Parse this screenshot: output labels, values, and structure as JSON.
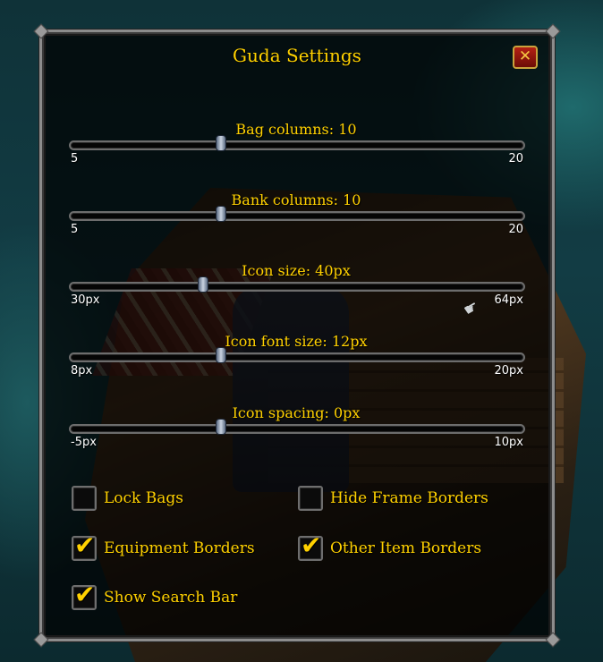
{
  "window": {
    "title": "Guda Settings",
    "close_glyph": "✕"
  },
  "sliders": [
    {
      "label": "Bag columns: 10",
      "min": "5",
      "max": "20",
      "value": 10,
      "range": [
        5,
        20
      ]
    },
    {
      "label": "Bank columns: 10",
      "min": "5",
      "max": "20",
      "value": 10,
      "range": [
        5,
        20
      ]
    },
    {
      "label": "Icon size: 40px",
      "min": "30px",
      "max": "64px",
      "value": 40,
      "range": [
        30,
        64
      ]
    },
    {
      "label": "Icon font size: 12px",
      "min": "8px",
      "max": "20px",
      "value": 12,
      "range": [
        8,
        20
      ]
    },
    {
      "label": "Icon spacing: 0px",
      "min": "-5px",
      "max": "10px",
      "value": 0,
      "range": [
        -5,
        10
      ]
    }
  ],
  "checkboxes": [
    {
      "label": "Lock Bags",
      "checked": false
    },
    {
      "label": "Hide Frame Borders",
      "checked": false
    },
    {
      "label": "Equipment Borders",
      "checked": true
    },
    {
      "label": "Other Item Borders",
      "checked": true
    },
    {
      "label": "Show Search Bar",
      "checked": true
    }
  ],
  "colors": {
    "label_gold": "#ffd100",
    "close_red": "#b32014",
    "border_gray": "#8c8c8c"
  },
  "icons": {
    "close": "close-icon",
    "check": "checkmark-icon",
    "cursor": "gauntlet-cursor-icon"
  }
}
